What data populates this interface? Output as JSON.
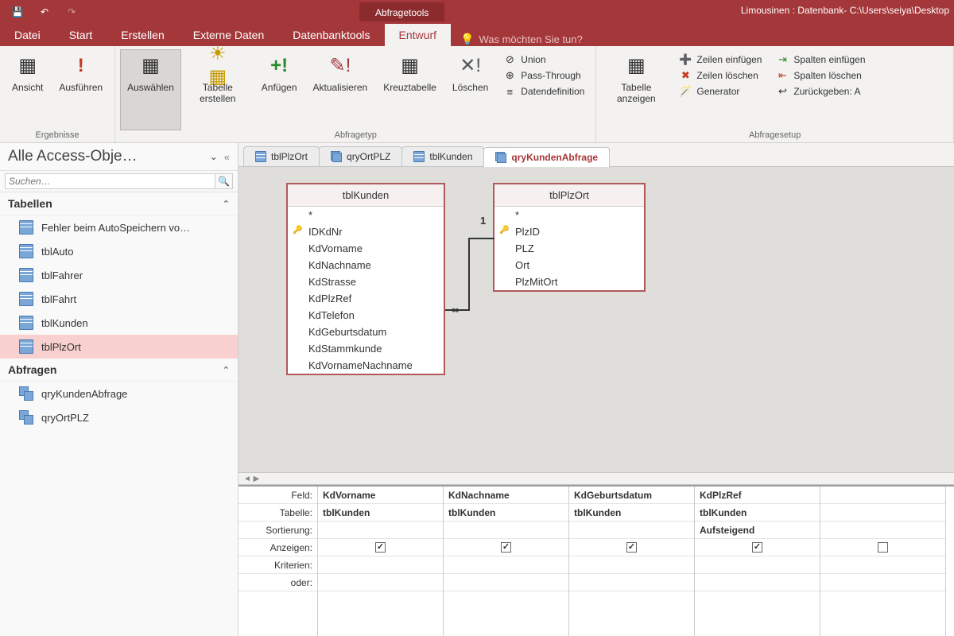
{
  "titlebar": {
    "context_tab": "Abfragetools",
    "window_title": "Limousinen : Datenbank- C:\\Users\\seiya\\Desktop"
  },
  "menu": {
    "items": [
      "Datei",
      "Start",
      "Erstellen",
      "Externe Daten",
      "Datenbanktools",
      "Entwurf"
    ],
    "active": "Entwurf",
    "tellme": "Was möchten Sie tun?"
  },
  "ribbon": {
    "groups": {
      "ergebnisse": {
        "label": "Ergebnisse",
        "ansicht": "Ansicht",
        "ausfuehren": "Ausführen"
      },
      "abfragetyp": {
        "label": "Abfragetyp",
        "auswaehlen": "Auswählen",
        "tabelle_erstellen": "Tabelle erstellen",
        "anfuegen": "Anfügen",
        "aktualisieren": "Aktualisieren",
        "kreuztabelle": "Kreuztabelle",
        "loeschen": "Löschen",
        "union": "Union",
        "passthrough": "Pass-Through",
        "datendef": "Datendefinition"
      },
      "setup": {
        "label": "Abfragesetup",
        "tabelle_anzeigen": "Tabelle anzeigen",
        "zeilen_einf": "Zeilen einfügen",
        "zeilen_loesch": "Zeilen löschen",
        "generator": "Generator",
        "spalten_einf": "Spalten einfügen",
        "spalten_loesch": "Spalten löschen",
        "zurueckgeben": "Zurückgeben:  A"
      }
    }
  },
  "nav": {
    "title": "Alle Access-Obje…",
    "search_placeholder": "Suchen…",
    "sections": {
      "tabellen": "Tabellen",
      "abfragen": "Abfragen"
    },
    "tables": [
      "Fehler beim AutoSpeichern vo…",
      "tblAuto",
      "tblFahrer",
      "tblFahrt",
      "tblKunden",
      "tblPlzOrt"
    ],
    "tables_selected": "tblPlzOrt",
    "queries": [
      "qryKundenAbfrage",
      "qryOrtPLZ"
    ]
  },
  "doctabs": {
    "items": [
      "tblPlzOrt",
      "qryOrtPLZ",
      "tblKunden",
      "qryKundenAbfrage"
    ],
    "active": "qryKundenAbfrage"
  },
  "designer": {
    "tblKunden": {
      "title": "tblKunden",
      "fields": [
        "*",
        "IDKdNr",
        "KdVorname",
        "KdNachname",
        "KdStrasse",
        "KdPlzRef",
        "KdTelefon",
        "KdGeburtsdatum",
        "KdStammkunde",
        "KdVornameNachname"
      ],
      "key": "IDKdNr"
    },
    "tblPlzOrt": {
      "title": "tblPlzOrt",
      "fields": [
        "*",
        "PlzID",
        "PLZ",
        "Ort",
        "PlzMitOrt"
      ],
      "key": "PlzID"
    },
    "rel": {
      "one": "1",
      "many": "∞"
    }
  },
  "grid": {
    "headers": {
      "feld": "Feld:",
      "tabelle": "Tabelle:",
      "sortierung": "Sortierung:",
      "anzeigen": "Anzeigen:",
      "kriterien": "Kriterien:",
      "oder": "oder:"
    },
    "cols": [
      {
        "feld": "KdVorname",
        "tabelle": "tblKunden",
        "sort": "",
        "show": true
      },
      {
        "feld": "KdNachname",
        "tabelle": "tblKunden",
        "sort": "",
        "show": true
      },
      {
        "feld": "KdGeburtsdatum",
        "tabelle": "tblKunden",
        "sort": "",
        "show": true
      },
      {
        "feld": "KdPlzRef",
        "tabelle": "tblKunden",
        "sort": "Aufsteigend",
        "show": true
      },
      {
        "feld": "",
        "tabelle": "",
        "sort": "",
        "show": false
      }
    ]
  }
}
